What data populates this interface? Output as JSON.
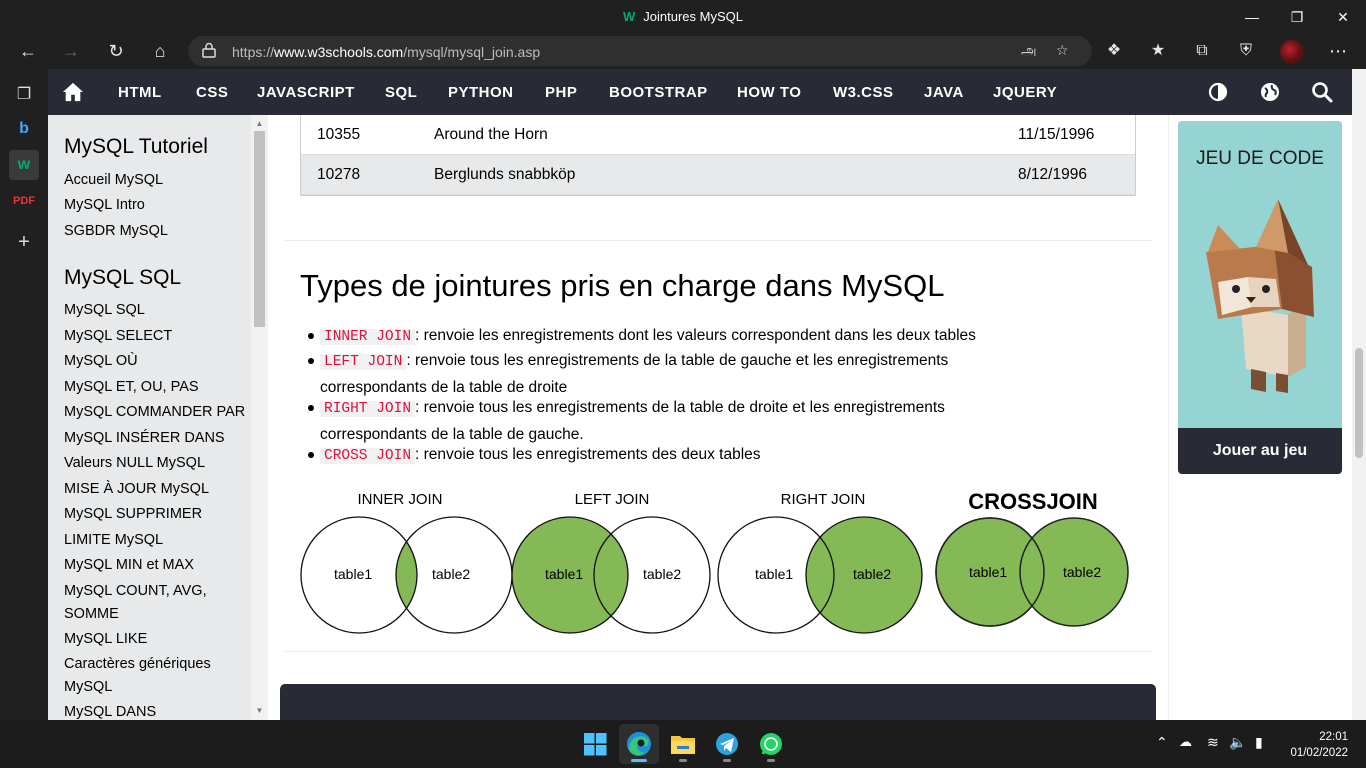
{
  "window": {
    "title": "Jointures MySQL"
  },
  "browser": {
    "url_prefix": "https://",
    "url_domain": "www.w3schools.com",
    "url_path": "/mysql/mysql_join.asp",
    "translate_label": "அ"
  },
  "topnav": {
    "items": [
      "HTML",
      "CSS",
      "JAVASCRIPT",
      "SQL",
      "PYTHON",
      "PHP",
      "BOOTSTRAP",
      "HOW TO",
      "W3.CSS",
      "JAVA",
      "JQUERY"
    ]
  },
  "sidebar": {
    "section1_title": "MySQL Tutoriel",
    "section1_items": [
      "Accueil MySQL",
      "MySQL Intro",
      "SGBDR MySQL"
    ],
    "section2_title": "MySQL SQL",
    "section2_items": [
      "MySQL SQL",
      "MySQL SELECT",
      "MySQL OÙ",
      "MySQL ET, OU, PAS",
      "MySQL COMMANDER PAR",
      "MySQL INSÉRER DANS",
      "Valeurs NULL MySQL",
      "MISE À JOUR MySQL",
      "MySQL SUPPRIMER",
      "LIMITE MySQL",
      "MySQL MIN et MAX",
      "MySQL COUNT, AVG, SOMME",
      "MySQL LIKE",
      "Caractères génériques MySQL",
      "MySQL DANS"
    ]
  },
  "table": {
    "rows": [
      {
        "id": "10355",
        "name": "Around the Horn",
        "date": "11/15/1996"
      },
      {
        "id": "10278",
        "name": "Berglunds snabbköp",
        "date": "8/12/1996"
      }
    ]
  },
  "content": {
    "heading": "Types de jointures pris en charge dans MySQL",
    "bullets": [
      {
        "code": "INNER JOIN",
        "line1": ": renvoie les enregistrements dont les valeurs correspondent dans les deux tables",
        "line2": ""
      },
      {
        "code": "LEFT JOIN",
        "line1": ": renvoie tous les enregistrements de la table de gauche et les enregistrements",
        "line2": "correspondants de la table de droite"
      },
      {
        "code": "RIGHT JOIN",
        "line1": ": renvoie tous les enregistrements de la table de droite et les enregistrements",
        "line2": "correspondants de la table de gauche."
      },
      {
        "code": "CROSS JOIN",
        "line1": ": renvoie tous les enregistrements des deux tables",
        "line2": ""
      }
    ]
  },
  "diagrams": [
    {
      "title": "INNER JOIN",
      "left": "table1",
      "right": "table2"
    },
    {
      "title": "LEFT JOIN",
      "left": "table1",
      "right": "table2"
    },
    {
      "title": "RIGHT JOIN",
      "left": "table1",
      "right": "table2"
    },
    {
      "title": "CROSSJOIN",
      "left": "table1",
      "right": "table2"
    }
  ],
  "colors": {
    "venn_fill": "#84B955",
    "nav_bg": "#282A35",
    "code_red": "#dc143c",
    "w3_green": "#04AA6D"
  },
  "ad": {
    "title": "JEU DE CODE",
    "button": "Jouer au jeu"
  },
  "taskbar": {
    "time": "22:01",
    "date": "01/02/2022"
  }
}
